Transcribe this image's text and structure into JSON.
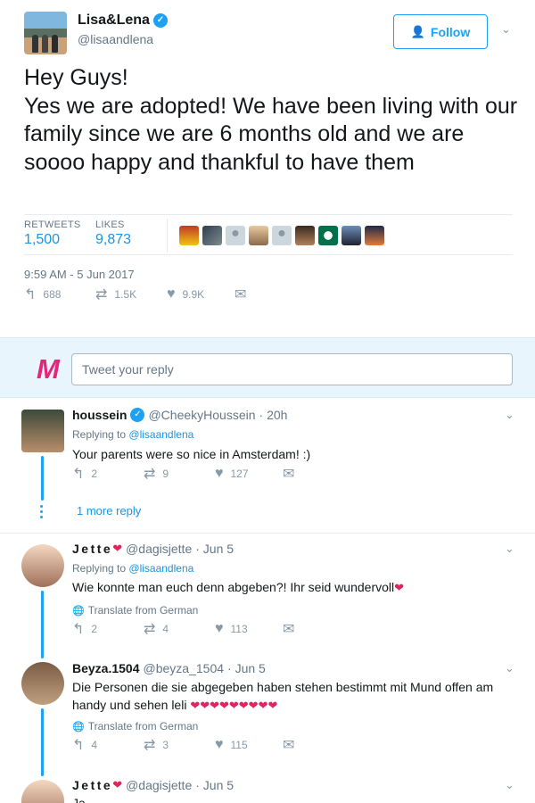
{
  "main": {
    "name": "Lisa&Lena",
    "handle": "@lisaandlena",
    "follow_label": "Follow",
    "text": "Hey Guys!\nYes we are adopted! We have been living with our family since we are 6 months old and we are soooo happy and thankful to have them",
    "retweets_label": "RETWEETS",
    "retweets": "1,500",
    "likes_label": "LIKES",
    "likes": "9,873",
    "timestamp": "9:59 AM - 5 Jun 2017",
    "actions": {
      "replies": "688",
      "retweets": "1.5K",
      "likes": "9.9K"
    }
  },
  "reply_box": {
    "placeholder": "Tweet your reply"
  },
  "replies": [
    {
      "name": "houssein",
      "handle": "@CheekyHoussein",
      "time": "· 20h",
      "replying_prefix": "Replying to",
      "replying_to": "@lisaandlena",
      "text": "Your parents were so nice in Amsterdam! :)",
      "replies": "2",
      "retweets": "9",
      "likes": "127",
      "more_label": "1 more reply"
    },
    {
      "name": "Jette",
      "handle": "@dagisjette",
      "time": "· Jun 5",
      "replying_prefix": "Replying to",
      "replying_to": "@lisaandlena",
      "text": "Wie konnte man euch denn abgeben?! Ihr seid wundervoll",
      "translate": "Translate from German",
      "replies": "2",
      "retweets": "4",
      "likes": "113"
    },
    {
      "name": "Beyza.1504",
      "handle": "@beyza_1504",
      "time": "· Jun 5",
      "text": "Die Personen die sie abgegeben haben stehen bestimmt mit Mund offen am handy und sehen leli",
      "translate": "Translate from German",
      "replies": "4",
      "retweets": "3",
      "likes": "115"
    },
    {
      "name": "Jette",
      "handle": "@dagisjette",
      "time": "· Jun 5",
      "text": "Ja"
    }
  ],
  "colors": {
    "accent": "#1da1f2",
    "heart": "#e0245e",
    "brand_m": "#e4257b"
  }
}
